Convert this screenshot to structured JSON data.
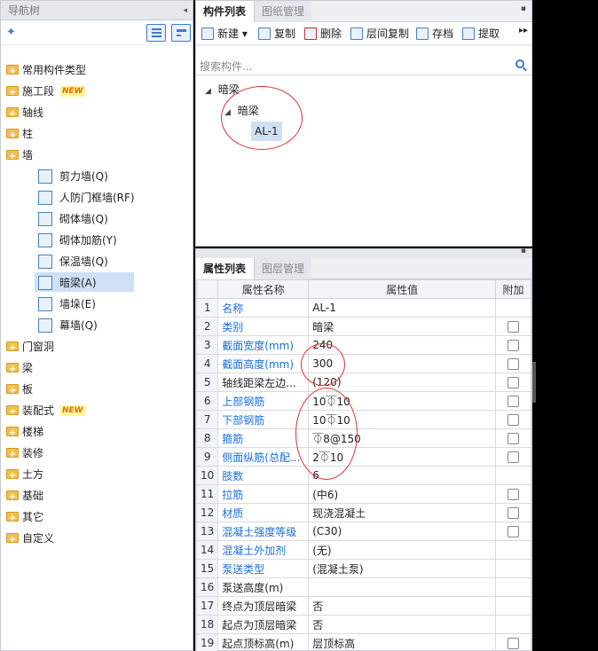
{
  "nav": {
    "title": "导航树",
    "items": [
      {
        "label": "常用构件类型",
        "type": "folder"
      },
      {
        "label": "施工段",
        "type": "folder",
        "badge": "NEW"
      },
      {
        "label": "轴线",
        "type": "folder"
      },
      {
        "label": "柱",
        "type": "folder"
      },
      {
        "label": "墙",
        "type": "folder-open"
      },
      {
        "label": "剪力墙(Q)",
        "type": "child",
        "icon": "shear-wall-icon"
      },
      {
        "label": "人防门框墙(RF)",
        "type": "child",
        "icon": "civil-defense-frame-icon"
      },
      {
        "label": "砌体墙(Q)",
        "type": "child",
        "icon": "masonry-wall-icon"
      },
      {
        "label": "砌体加筋(Y)",
        "type": "child",
        "icon": "masonry-rebar-icon"
      },
      {
        "label": "保温墙(Q)",
        "type": "child",
        "icon": "insulation-wall-icon"
      },
      {
        "label": "暗梁(A)",
        "type": "child",
        "icon": "hidden-beam-icon",
        "selected": true
      },
      {
        "label": "墙垛(E)",
        "type": "child",
        "icon": "wall-pier-icon"
      },
      {
        "label": "幕墙(Q)",
        "type": "child",
        "icon": "curtain-wall-icon"
      },
      {
        "label": "门窗洞",
        "type": "folder"
      },
      {
        "label": "梁",
        "type": "folder"
      },
      {
        "label": "板",
        "type": "folder"
      },
      {
        "label": "装配式",
        "type": "folder",
        "badge": "NEW"
      },
      {
        "label": "楼梯",
        "type": "folder"
      },
      {
        "label": "装修",
        "type": "folder"
      },
      {
        "label": "土方",
        "type": "folder"
      },
      {
        "label": "基础",
        "type": "folder"
      },
      {
        "label": "其它",
        "type": "folder"
      },
      {
        "label": "自定义",
        "type": "folder"
      }
    ]
  },
  "components": {
    "tabs": [
      "构件列表",
      "图纸管理"
    ],
    "toolbar": {
      "new": "新建",
      "copy": "复制",
      "delete": "删除",
      "floor_copy": "层间复制",
      "save": "存档",
      "extract": "提取"
    },
    "search_placeholder": "搜索构件...",
    "tree": {
      "root": "暗梁",
      "group": "暗梁",
      "item": "AL-1"
    }
  },
  "properties": {
    "tabs": [
      "属性列表",
      "图层管理"
    ],
    "headers": [
      "属性名称",
      "属性值",
      "附加"
    ],
    "rows": [
      {
        "n": "1",
        "name": "名称",
        "value": "AL-1",
        "blue": true,
        "check": false
      },
      {
        "n": "2",
        "name": "类别",
        "value": "暗梁",
        "blue": true,
        "check": true
      },
      {
        "n": "3",
        "name": "截面宽度(mm)",
        "value": "240",
        "blue": true,
        "check": true
      },
      {
        "n": "4",
        "name": "截面高度(mm)",
        "value": "300",
        "blue": true,
        "check": true
      },
      {
        "n": "5",
        "name": "轴线距梁左边...",
        "value": "(120)",
        "blue": false,
        "check": true
      },
      {
        "n": "6",
        "name": "上部钢筋",
        "value": "10⏁10",
        "blue": true,
        "check": true
      },
      {
        "n": "7",
        "name": "下部钢筋",
        "value": "10⏁10",
        "blue": true,
        "check": true
      },
      {
        "n": "8",
        "name": "箍筋",
        "value": "⏁8@150",
        "blue": true,
        "check": true
      },
      {
        "n": "9",
        "name": "侧面纵筋(总配...",
        "value": "2⏁10",
        "blue": true,
        "check": true
      },
      {
        "n": "10",
        "name": "肢数",
        "value": "6",
        "blue": true,
        "check": false
      },
      {
        "n": "11",
        "name": "拉筋",
        "value": "(中6)",
        "blue": true,
        "check": true
      },
      {
        "n": "12",
        "name": "材质",
        "value": "现浇混凝土",
        "blue": true,
        "check": true
      },
      {
        "n": "13",
        "name": "混凝土强度等级",
        "value": "(C30)",
        "blue": true,
        "check": true
      },
      {
        "n": "14",
        "name": "混凝土外加剂",
        "value": "(无)",
        "blue": true,
        "check": false
      },
      {
        "n": "15",
        "name": "泵送类型",
        "value": "(混凝土泵)",
        "blue": true,
        "check": false
      },
      {
        "n": "16",
        "name": "泵送高度(m)",
        "value": "",
        "blue": false,
        "check": false
      },
      {
        "n": "17",
        "name": "终点为顶层暗梁",
        "value": "否",
        "blue": false,
        "check": false
      },
      {
        "n": "18",
        "name": "起点为顶层暗梁",
        "value": "否",
        "blue": false,
        "check": false
      },
      {
        "n": "19",
        "name": "起点顶标高(m)",
        "value": "层顶标高",
        "blue": false,
        "check": true
      }
    ]
  }
}
